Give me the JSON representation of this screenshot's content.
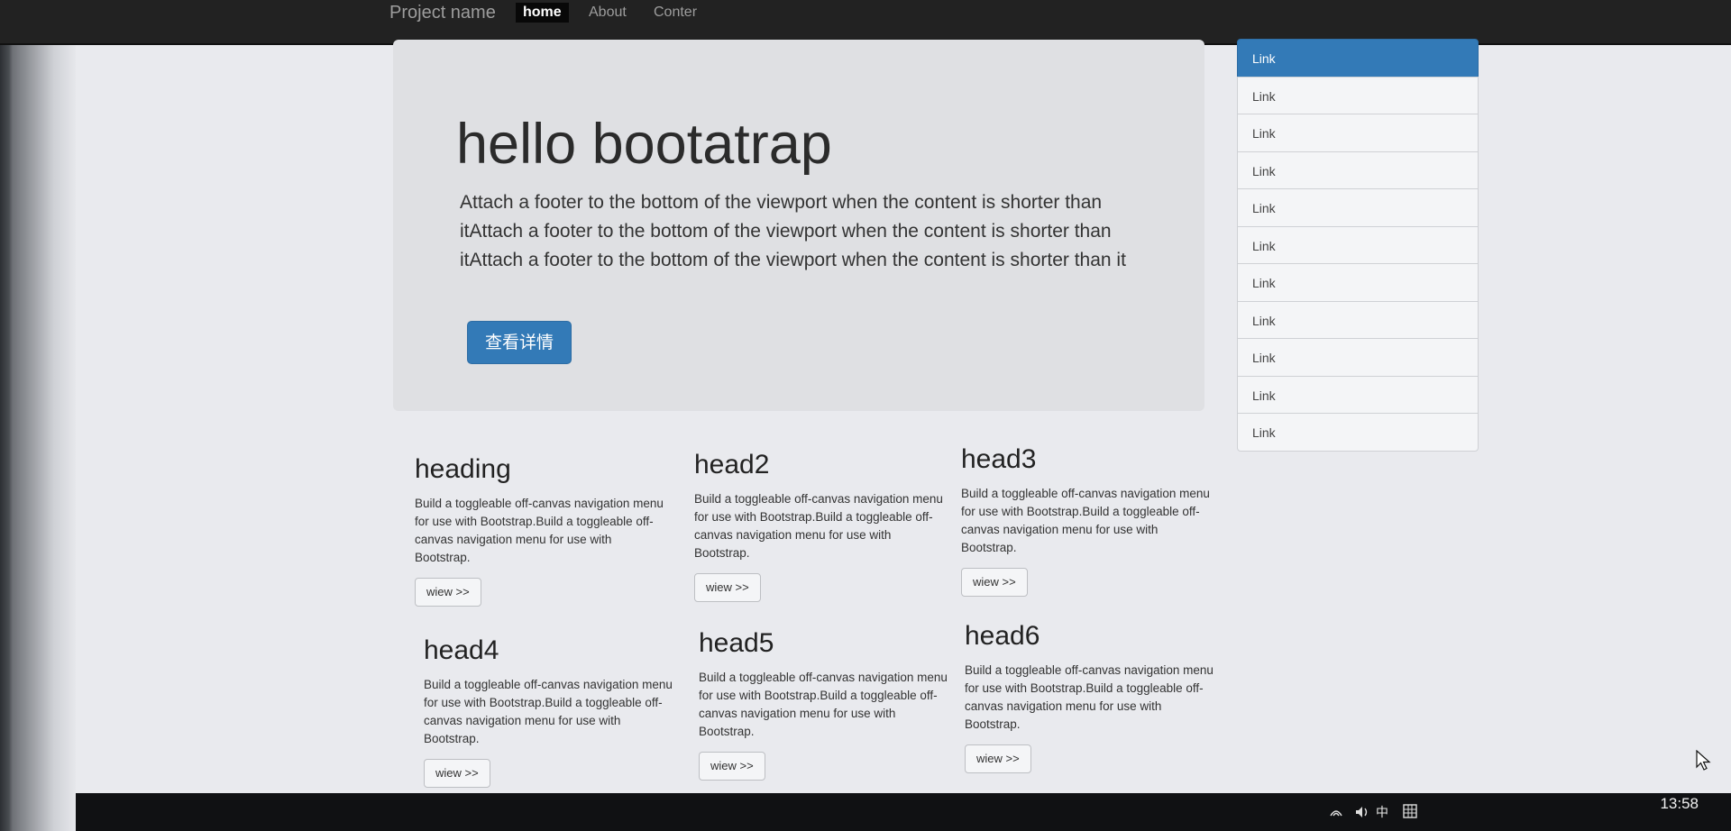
{
  "navbar": {
    "brand": "Project name",
    "items": [
      {
        "label": "home",
        "active": true
      },
      {
        "label": "About",
        "active": false
      },
      {
        "label": "Conter",
        "active": false
      }
    ]
  },
  "jumbotron": {
    "title": "hello bootatrap",
    "text": "Attach a footer to the bottom of the viewport when the content is shorter than itAttach a footer to the bottom of the viewport when the content is shorter than itAttach a footer to the bottom of the viewport when the content is shorter than it",
    "button_label": "查看详情"
  },
  "sidebar": {
    "items": [
      "Link",
      "Link",
      "Link",
      "Link",
      "Link",
      "Link",
      "Link",
      "Link",
      "Link",
      "Link",
      "Link"
    ],
    "active_index": 0
  },
  "cards": [
    {
      "heading": "heading",
      "body": "Build a toggleable off-canvas navigation menu for use with Bootstrap.Build a toggleable off-canvas navigation menu for use with Bootstrap.",
      "button": "wiew >>"
    },
    {
      "heading": "head2",
      "body": "Build a toggleable off-canvas navigation menu for use with Bootstrap.Build a toggleable off-canvas navigation menu for use with Bootstrap.",
      "button": "wiew >>"
    },
    {
      "heading": "head3",
      "body": "Build a toggleable off-canvas navigation menu for use with Bootstrap.Build a toggleable off-canvas navigation menu for use with Bootstrap.",
      "button": "wiew >>"
    },
    {
      "heading": "head4",
      "body": "Build a toggleable off-canvas navigation menu for use with Bootstrap.Build a toggleable off-canvas navigation menu for use with Bootstrap.",
      "button": "wiew >>"
    },
    {
      "heading": "head5",
      "body": "Build a toggleable off-canvas navigation menu for use with Bootstrap.Build a toggleable off-canvas navigation menu for use with Bootstrap.",
      "button": "wiew >>"
    },
    {
      "heading": "head6",
      "body": "Build a toggleable off-canvas navigation menu for use with Bootstrap.Build a toggleable off-canvas navigation menu for use with Bootstrap.",
      "button": "wiew >>"
    }
  ],
  "taskbar": {
    "ime": "中",
    "time": "13:58"
  },
  "colors": {
    "primary": "#337ab7",
    "navbar": "#222222"
  }
}
